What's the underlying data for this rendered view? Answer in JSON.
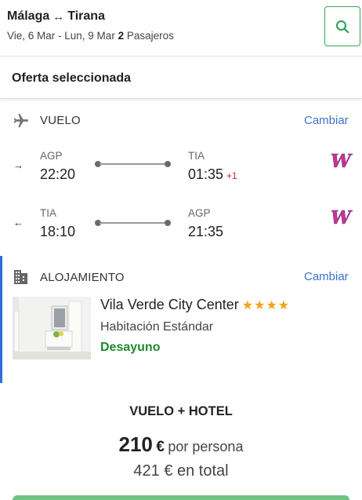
{
  "header": {
    "origin": "Málaga",
    "route_arrow": "↔",
    "destination": "Tirana",
    "dates": "Vie, 6 Mar - Lun, 9 Mar",
    "passengers_count": "2",
    "passengers_label": "Pasajeros",
    "search_icon": "search-icon"
  },
  "offer": {
    "title": "Oferta seleccionada"
  },
  "flight": {
    "label": "VUELO",
    "change_label": "Cambiar",
    "outbound": {
      "direction": "→",
      "from_code": "AGP",
      "from_time": "22:20",
      "to_code": "TIA",
      "to_time": "01:35",
      "plus_day": "+1",
      "airline_logo": "W"
    },
    "inbound": {
      "direction": "←",
      "from_code": "TIA",
      "from_time": "18:10",
      "to_code": "AGP",
      "to_time": "21:35",
      "airline_logo": "W"
    }
  },
  "hotel": {
    "label": "ALOJAMIENTO",
    "change_label": "Cambiar",
    "name": "Vila Verde City Center",
    "stars": "★★★★",
    "star_count": 4,
    "room": "Habitación Estándar",
    "board": "Desayuno"
  },
  "total": {
    "package_title": "VUELO + HOTEL",
    "price_per_person": "210",
    "currency": "€",
    "per_person_label": "por persona",
    "total_amount": "421",
    "total_label": "€ en total"
  },
  "colors": {
    "accent_green": "#3aa35a",
    "link_blue": "#3b73c9",
    "board_green": "#1f8a2e",
    "star": "#f3a21b",
    "plus_day_red": "#d0242b"
  }
}
